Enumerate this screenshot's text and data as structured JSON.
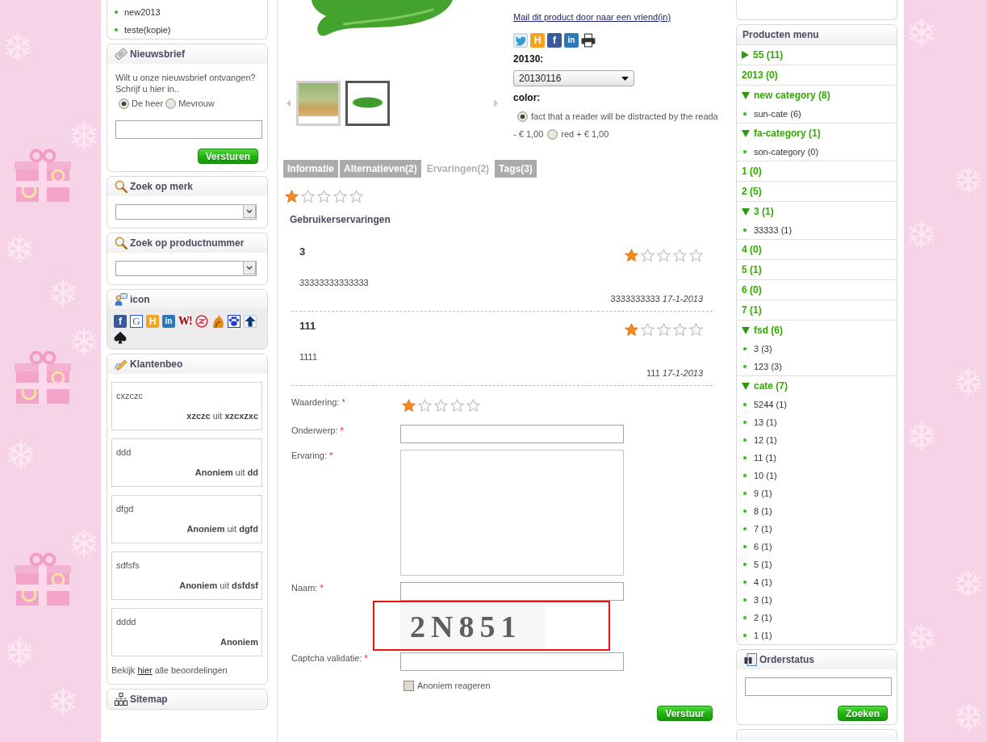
{
  "left_sidebar": {
    "category_list": {
      "items": [
        {
          "label": "new2013"
        },
        {
          "label": "teste(kopie)"
        }
      ]
    },
    "newsletter": {
      "title": "Nieuwsbrief",
      "text": "Wilt u onze nieuwsbrief ontvangen? Schrijf u hier in..",
      "salutations": [
        {
          "label": "De heer",
          "selected": true
        },
        {
          "label": "Mevrouw",
          "selected": false
        }
      ],
      "button": "Versturen"
    },
    "brand_search": {
      "title": "Zoek op merk"
    },
    "number_search": {
      "title": "Zoek op productnummer"
    },
    "icon_panel": {
      "title": "icon",
      "icons": [
        {
          "kind": "tile",
          "glyph": "f",
          "color": "#3b5998"
        },
        {
          "kind": "framed",
          "glyph": "G",
          "color": "#2a5bd7"
        },
        {
          "kind": "tile",
          "glyph": "H",
          "color": "#f4a425"
        },
        {
          "kind": "tile",
          "glyph": "in",
          "color": "#2c78b8"
        },
        {
          "kind": "letters",
          "glyph": "W!",
          "color": "#9b0a0a"
        },
        {
          "kind": "ring",
          "color": "#d93a4a"
        },
        {
          "kind": "flame",
          "color": "#e58a12"
        },
        {
          "kind": "paw",
          "color": "#1d3fd6"
        },
        {
          "kind": "arrow",
          "color": "#0b3a78"
        },
        {
          "kind": "spade",
          "color": "#1a1a1a"
        }
      ]
    },
    "customer_reviews": {
      "title": "Klantenbeo",
      "items": [
        {
          "text": "cxzczc",
          "author": "xzczc",
          "from": "uit",
          "place": "xzcxzxc"
        },
        {
          "text": "ddd",
          "author": "Anoniem",
          "from": "uit",
          "place": "dd"
        },
        {
          "text": "dfgd",
          "author": "Anoniem",
          "from": "uit",
          "place": "dgfd"
        },
        {
          "text": "sdfsfs",
          "author": "Anoniem",
          "from": "uit",
          "place": "dsfdsf"
        },
        {
          "text": "dddd",
          "author": "Anoniem"
        }
      ],
      "footer": {
        "before": "Bekijk",
        "link": "hier",
        "after": "alle beoordelingen"
      }
    },
    "sitemap": {
      "title": "Sitemap"
    }
  },
  "product": {
    "mail_link": "Mail dit product door naar een vriend(in)",
    "share_icons": [
      {
        "kind": "bird",
        "color": "#2f9ad8"
      },
      {
        "kind": "tile",
        "glyph": "H",
        "color": "#f4a425"
      },
      {
        "kind": "tile",
        "glyph": "f",
        "color": "#3b5998"
      },
      {
        "kind": "tile",
        "glyph": "in",
        "color": "#2c78b8"
      },
      {
        "kind": "printer",
        "color": "#333333"
      }
    ],
    "thumbnails": [
      {
        "selected": false
      },
      {
        "selected": true
      }
    ],
    "options": [
      {
        "kind": "select",
        "label": "20130:",
        "value": "20130116"
      },
      {
        "kind": "radio",
        "label": "color:",
        "choices": [
          {
            "label": "fact that a reader will be distracted by the reada",
            "price": "- € 1,00",
            "selected": true
          },
          {
            "label": "red + € 1,00",
            "selected": false
          }
        ]
      }
    ],
    "tabs": [
      {
        "label": "Informatie",
        "selected": false
      },
      {
        "label": "Alternatieven(2)",
        "selected": false
      },
      {
        "label": "Ervaringen(2)",
        "selected": true
      },
      {
        "label": "Tags(3)",
        "selected": false
      }
    ],
    "rating": {
      "stars": 1
    },
    "reviews_title": "Gebruikerservaringen",
    "reviews": [
      {
        "title": "3",
        "stars": 1,
        "body": "33333333333333",
        "author": "3333333333",
        "date": "17-1-2013"
      },
      {
        "title": "111",
        "stars": 1,
        "body": "1111",
        "author": "111",
        "date": "17-1-2013"
      }
    ],
    "form": {
      "fields": [
        {
          "kind": "rating",
          "label": "Waardering:",
          "mark": "*",
          "stars": 1
        },
        {
          "kind": "text",
          "label": "Onderwerp:",
          "mark": "*"
        },
        {
          "kind": "textarea",
          "label": "Ervaring:",
          "mark": "*"
        },
        {
          "kind": "text",
          "label": "Naam:",
          "mark": "*"
        },
        {
          "kind": "captcha",
          "code": "2N851"
        },
        {
          "kind": "text",
          "label": "Captcha validatie:",
          "mark": "*"
        }
      ],
      "anonymous": {
        "label": "Anoniem reageren",
        "checked": false
      },
      "submit": "Verstuur"
    }
  },
  "right_sidebar": {
    "products_menu": {
      "title": "Producten menu",
      "items": [
        {
          "kind": "group",
          "label": "55 (11)",
          "expanded": false
        },
        {
          "kind": "link",
          "label": "2013 (0)"
        },
        {
          "kind": "group",
          "label": "new category (8)",
          "expanded": true,
          "children": [
            {
              "label": "sun-cate (6)"
            }
          ]
        },
        {
          "kind": "group",
          "label": "fa-category (1)",
          "expanded": true,
          "children": [
            {
              "label": "son-category (0)"
            }
          ]
        },
        {
          "kind": "link",
          "label": "1 (0)"
        },
        {
          "kind": "link",
          "label": "2 (5)"
        },
        {
          "kind": "group",
          "label": "3 (1)",
          "expanded": true,
          "children": [
            {
              "label": "33333 (1)"
            }
          ]
        },
        {
          "kind": "link",
          "label": "4 (0)"
        },
        {
          "kind": "link",
          "label": "5 (1)"
        },
        {
          "kind": "link",
          "label": "6 (0)"
        },
        {
          "kind": "link",
          "label": "7 (1)"
        },
        {
          "kind": "group",
          "label": "fsd (6)",
          "expanded": true,
          "children": [
            {
              "label": "3 (3)"
            },
            {
              "label": "123 (3)"
            }
          ]
        },
        {
          "kind": "group",
          "label": "cate (7)",
          "expanded": true,
          "children": [
            {
              "label": "5244 (1)"
            },
            {
              "label": "13 (1)"
            },
            {
              "label": "12 (1)"
            },
            {
              "label": "11 (1)"
            },
            {
              "label": "10 (1)"
            },
            {
              "label": "9 (1)"
            },
            {
              "label": "8 (1)"
            },
            {
              "label": "7 (1)"
            },
            {
              "label": "6 (1)"
            },
            {
              "label": "5 (1)"
            },
            {
              "label": "4 (1)"
            },
            {
              "label": "3 (1)"
            },
            {
              "label": "2 (1)"
            },
            {
              "label": "1 (1)"
            }
          ]
        }
      ]
    },
    "order_status": {
      "title": "Orderstatus",
      "button": "Zoeken"
    }
  }
}
